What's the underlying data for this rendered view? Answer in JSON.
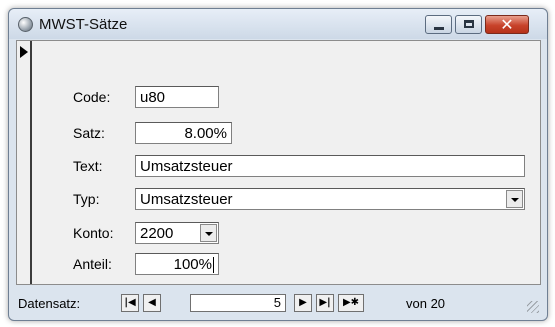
{
  "window": {
    "title": "MWST-Sätze"
  },
  "form": {
    "code": {
      "label": "Code:",
      "value": "u80"
    },
    "satz": {
      "label": "Satz:",
      "value": "8.00%"
    },
    "text": {
      "label": "Text:",
      "value": "Umsatzsteuer"
    },
    "typ": {
      "label": "Typ:",
      "value": "Umsatzsteuer"
    },
    "konto": {
      "label": "Konto:",
      "value": "2200"
    },
    "anteil": {
      "label": "Anteil:",
      "value": "100%"
    }
  },
  "nav": {
    "label": "Datensatz:",
    "current": "5",
    "of_label": "von 20",
    "icons": {
      "first": "first-record-icon",
      "prev": "previous-record-icon",
      "next": "next-record-icon",
      "last": "last-record-icon",
      "new": "new-record-icon"
    }
  },
  "colors": {
    "close_button": "#c8432b",
    "title_bar": "#dbe4ee"
  }
}
